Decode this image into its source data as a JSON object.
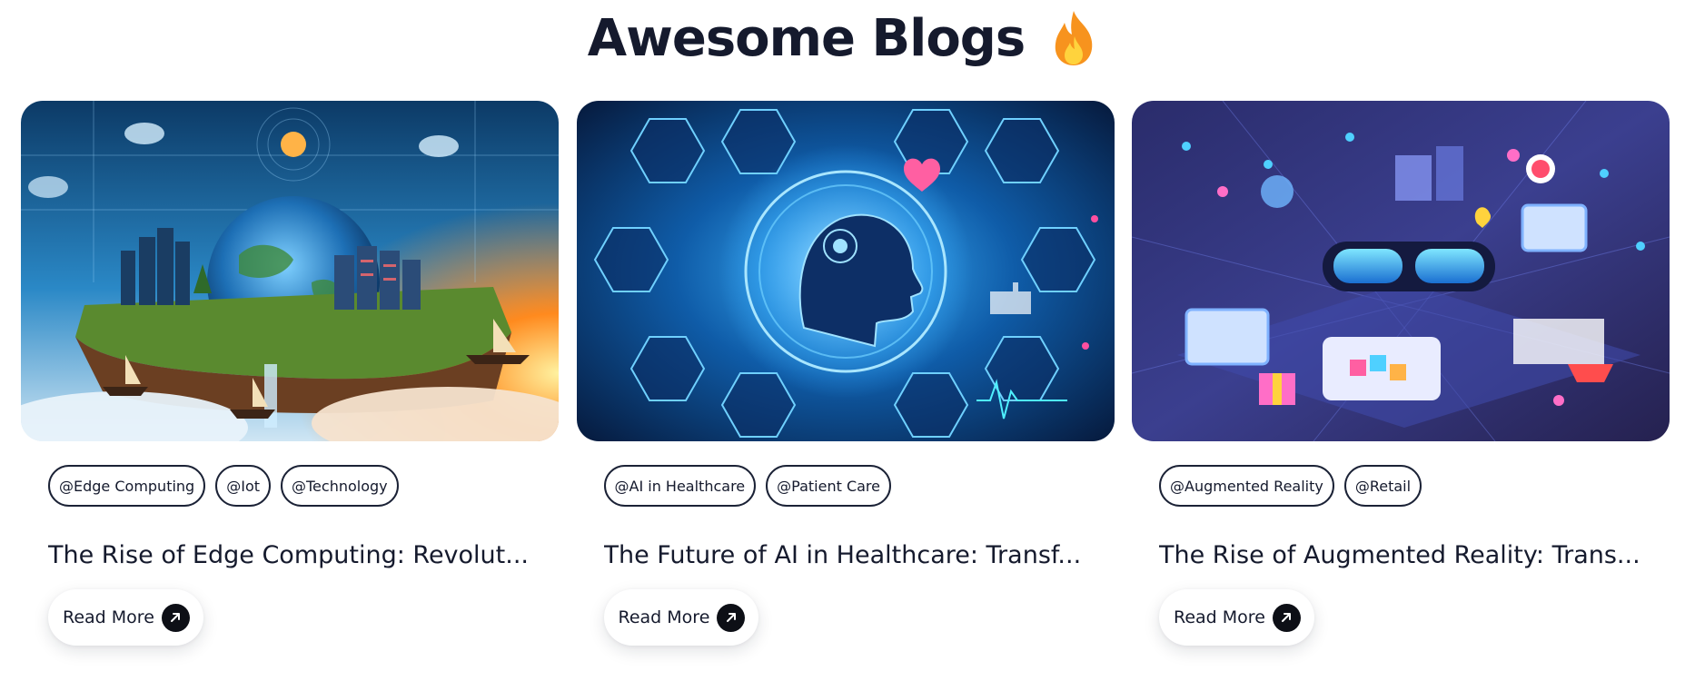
{
  "header": {
    "title": "Awesome Blogs",
    "icon": "fire-icon"
  },
  "colors": {
    "text": "#151a2d",
    "tag_border": "#1b2236",
    "arrow_bg": "#0d0f16",
    "fire_outer": "#f7931e",
    "fire_inner": "#ffd33d"
  },
  "cards": [
    {
      "image_icon": "edge-computing-illustration",
      "tags": [
        "@Edge Computing",
        "@Iot",
        "@Technology"
      ],
      "title": "The Rise of Edge Computing: Revolut...",
      "read_more_label": "Read More",
      "read_more_icon": "arrow-up-right-icon"
    },
    {
      "image_icon": "ai-healthcare-illustration",
      "tags": [
        "@AI in Healthcare",
        "@Patient Care"
      ],
      "title": "The Future of AI in Healthcare: Transf...",
      "read_more_label": "Read More",
      "read_more_icon": "arrow-up-right-icon"
    },
    {
      "image_icon": "augmented-reality-illustration",
      "tags": [
        "@Augmented Reality",
        "@Retail"
      ],
      "title": "The Rise of Augmented Reality: Trans...",
      "read_more_label": "Read More",
      "read_more_icon": "arrow-up-right-icon"
    }
  ]
}
